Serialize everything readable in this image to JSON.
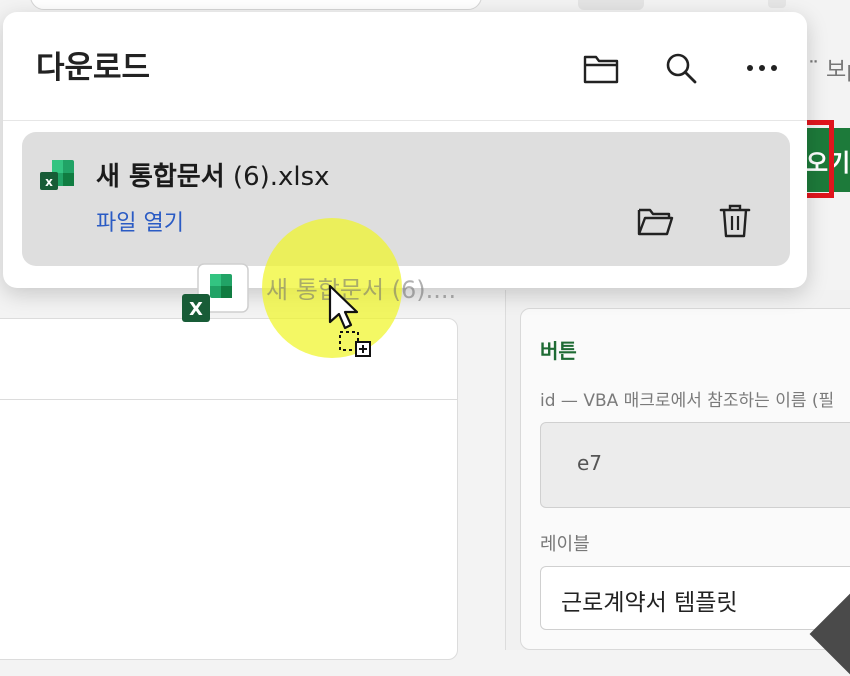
{
  "background": {
    "right_snippet": "¨ 보р",
    "green_button_label": "오기",
    "card_title": "버튼",
    "card_id_hint": "id — VBA 매크로에서 참조하는 이름 (필",
    "card_id_value": "e7",
    "card_label_caption": "레이블",
    "card_label_value": "근로계약서 템플릿"
  },
  "downloads": {
    "title": "다운로드",
    "items": [
      {
        "filename_main": "새 통합문서",
        "filename_rest": " (6).xlsx",
        "open_link": "파일 열기"
      }
    ]
  },
  "drag": {
    "ghost_label": "새 통합문서 (6)...."
  },
  "colors": {
    "accent_link": "#2a5bc4",
    "excel_green": "#1d7a3a",
    "highlight_box": "#e0151d",
    "cursor_highlight": "#f0f528"
  }
}
